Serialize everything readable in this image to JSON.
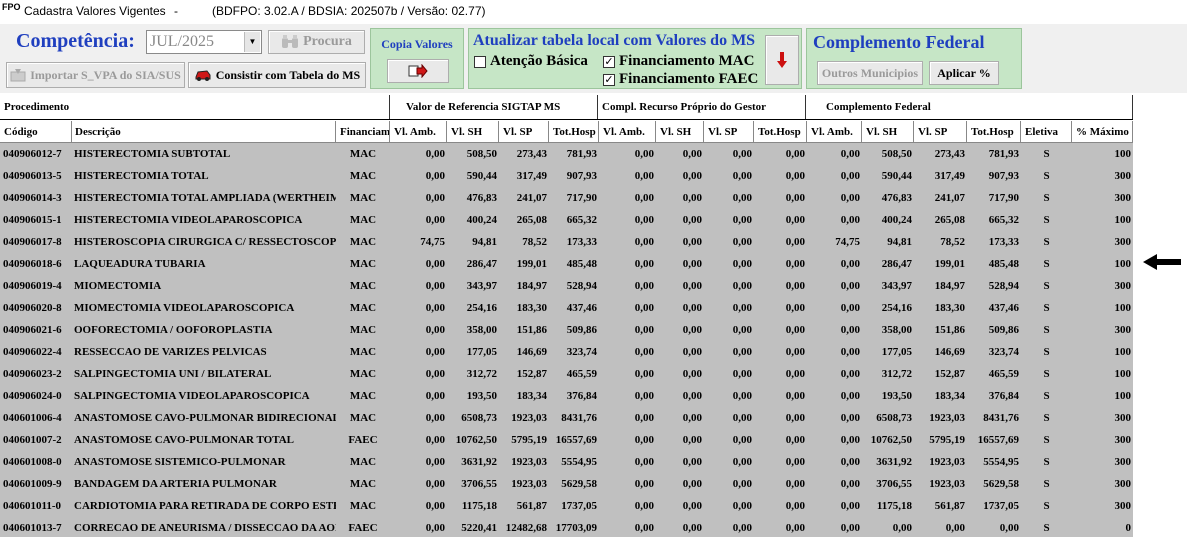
{
  "window": {
    "app_icon": "FPO",
    "title": "Cadastra Valores Vigentes",
    "separator": "-",
    "version": "(BDFPO: 3.02.A / BDSIA: 202507b / Versão: 02.77)"
  },
  "toolbar": {
    "competencia_label": "Competência:",
    "competencia_value": "JUL/2025",
    "procura_label": "Procura",
    "importar_label": "Importar S_VPA do SIA/SUS",
    "consistir_label": "Consistir com Tabela do MS",
    "copia_label": "Copia Valores",
    "atualizar_label": "Atualizar tabela local com Valores do MS",
    "atencao_basica_label": "Atenção Básica",
    "atencao_basica_checked": false,
    "fin_mac_label": "Financiamento MAC",
    "fin_mac_checked": true,
    "fin_faec_label": "Financiamento FAEC",
    "fin_faec_checked": true,
    "complemento_label": "Complemento Federal",
    "outros_label": "Outros Municipios",
    "aplicar_label": "Aplicar %"
  },
  "icons": {
    "procura": "binoculars-icon",
    "importar": "import-icon",
    "consistir": "car-icon",
    "copia": "copy-arrow-icon",
    "atualizar": "down-arrow-icon",
    "row_pointer": "left-arrow-icon"
  },
  "colors": {
    "accent_blue": "#1f3fbf",
    "panel_green": "#c6e6c6",
    "grid_row_bg": "#c0c0c0",
    "down_arrow_red": "#cc1010"
  },
  "grid": {
    "group_headers": [
      "Procedimento",
      "Valor de Referencia SIGTAP MS",
      "Compl. Recurso Próprio do Gestor",
      "Complemento Federal"
    ],
    "columns": [
      "Código",
      "Descrição",
      "Financiam",
      "Vl. Amb.",
      "Vl. SH",
      "Vl. SP",
      "Tot.Hosp",
      "Vl. Amb.",
      "Vl. SH",
      "Vl. SP",
      "Tot.Hosp",
      "Vl. Amb.",
      "Vl. SH",
      "Vl. SP",
      "Tot.Hosp",
      "Eletiva",
      "% Máximo"
    ],
    "rows": [
      [
        "040906012-7",
        "HISTERECTOMIA SUBTOTAL",
        "MAC",
        "0,00",
        "508,50",
        "273,43",
        "781,93",
        "0,00",
        "0,00",
        "0,00",
        "0,00",
        "0,00",
        "508,50",
        "273,43",
        "781,93",
        "S",
        "100"
      ],
      [
        "040906013-5",
        "HISTERECTOMIA TOTAL",
        "MAC",
        "0,00",
        "590,44",
        "317,49",
        "907,93",
        "0,00",
        "0,00",
        "0,00",
        "0,00",
        "0,00",
        "590,44",
        "317,49",
        "907,93",
        "S",
        "300"
      ],
      [
        "040906014-3",
        "HISTERECTOMIA TOTAL AMPLIADA (WERTHEIM-",
        "MAC",
        "0,00",
        "476,83",
        "241,07",
        "717,90",
        "0,00",
        "0,00",
        "0,00",
        "0,00",
        "0,00",
        "476,83",
        "241,07",
        "717,90",
        "S",
        "300"
      ],
      [
        "040906015-1",
        "HISTERECTOMIA VIDEOLAPAROSCOPICA",
        "MAC",
        "0,00",
        "400,24",
        "265,08",
        "665,32",
        "0,00",
        "0,00",
        "0,00",
        "0,00",
        "0,00",
        "400,24",
        "265,08",
        "665,32",
        "S",
        "100"
      ],
      [
        "040906017-8",
        "HISTEROSCOPIA CIRURGICA C/ RESSECTOSCOPIO",
        "MAC",
        "74,75",
        "94,81",
        "78,52",
        "173,33",
        "0,00",
        "0,00",
        "0,00",
        "0,00",
        "74,75",
        "94,81",
        "78,52",
        "173,33",
        "S",
        "300"
      ],
      [
        "040906018-6",
        "LAQUEADURA TUBARIA",
        "MAC",
        "0,00",
        "286,47",
        "199,01",
        "485,48",
        "0,00",
        "0,00",
        "0,00",
        "0,00",
        "0,00",
        "286,47",
        "199,01",
        "485,48",
        "S",
        "100"
      ],
      [
        "040906019-4",
        "MIOMECTOMIA",
        "MAC",
        "0,00",
        "343,97",
        "184,97",
        "528,94",
        "0,00",
        "0,00",
        "0,00",
        "0,00",
        "0,00",
        "343,97",
        "184,97",
        "528,94",
        "S",
        "300"
      ],
      [
        "040906020-8",
        "MIOMECTOMIA VIDEOLAPAROSCOPICA",
        "MAC",
        "0,00",
        "254,16",
        "183,30",
        "437,46",
        "0,00",
        "0,00",
        "0,00",
        "0,00",
        "0,00",
        "254,16",
        "183,30",
        "437,46",
        "S",
        "100"
      ],
      [
        "040906021-6",
        "OOFORECTOMIA / OOFOROPLASTIA",
        "MAC",
        "0,00",
        "358,00",
        "151,86",
        "509,86",
        "0,00",
        "0,00",
        "0,00",
        "0,00",
        "0,00",
        "358,00",
        "151,86",
        "509,86",
        "S",
        "300"
      ],
      [
        "040906022-4",
        "RESSECCAO DE VARIZES PELVICAS",
        "MAC",
        "0,00",
        "177,05",
        "146,69",
        "323,74",
        "0,00",
        "0,00",
        "0,00",
        "0,00",
        "0,00",
        "177,05",
        "146,69",
        "323,74",
        "S",
        "100"
      ],
      [
        "040906023-2",
        "SALPINGECTOMIA UNI / BILATERAL",
        "MAC",
        "0,00",
        "312,72",
        "152,87",
        "465,59",
        "0,00",
        "0,00",
        "0,00",
        "0,00",
        "0,00",
        "312,72",
        "152,87",
        "465,59",
        "S",
        "100"
      ],
      [
        "040906024-0",
        "SALPINGECTOMIA VIDEOLAPAROSCOPICA",
        "MAC",
        "0,00",
        "193,50",
        "183,34",
        "376,84",
        "0,00",
        "0,00",
        "0,00",
        "0,00",
        "0,00",
        "193,50",
        "183,34",
        "376,84",
        "S",
        "100"
      ],
      [
        "040601006-4",
        "ANASTOMOSE CAVO-PULMONAR BIDIRECIONAL",
        "MAC",
        "0,00",
        "6508,73",
        "1923,03",
        "8431,76",
        "0,00",
        "0,00",
        "0,00",
        "0,00",
        "0,00",
        "6508,73",
        "1923,03",
        "8431,76",
        "S",
        "300"
      ],
      [
        "040601007-2",
        "ANASTOMOSE CAVO-PULMONAR TOTAL",
        "FAEC",
        "0,00",
        "10762,50",
        "5795,19",
        "16557,69",
        "0,00",
        "0,00",
        "0,00",
        "0,00",
        "0,00",
        "10762,50",
        "5795,19",
        "16557,69",
        "S",
        "300"
      ],
      [
        "040601008-0",
        "ANASTOMOSE SISTEMICO-PULMONAR",
        "MAC",
        "0,00",
        "3631,92",
        "1923,03",
        "5554,95",
        "0,00",
        "0,00",
        "0,00",
        "0,00",
        "0,00",
        "3631,92",
        "1923,03",
        "5554,95",
        "S",
        "300"
      ],
      [
        "040601009-9",
        "BANDAGEM DA ARTERIA PULMONAR",
        "MAC",
        "0,00",
        "3706,55",
        "1923,03",
        "5629,58",
        "0,00",
        "0,00",
        "0,00",
        "0,00",
        "0,00",
        "3706,55",
        "1923,03",
        "5629,58",
        "S",
        "300"
      ],
      [
        "040601011-0",
        "CARDIOTOMIA PARA RETIRADA DE CORPO ESTRANHO",
        "MAC",
        "0,00",
        "1175,18",
        "561,87",
        "1737,05",
        "0,00",
        "0,00",
        "0,00",
        "0,00",
        "0,00",
        "1175,18",
        "561,87",
        "1737,05",
        "S",
        "300"
      ],
      [
        "040601013-7",
        "CORRECAO DE ANEURISMA / DISSECCAO DA AORTA",
        "FAEC",
        "0,00",
        "5220,41",
        "12482,68",
        "17703,09",
        "0,00",
        "0,00",
        "0,00",
        "0,00",
        "0,00",
        "0,00",
        "0,00",
        "0,00",
        "S",
        "0"
      ]
    ]
  }
}
